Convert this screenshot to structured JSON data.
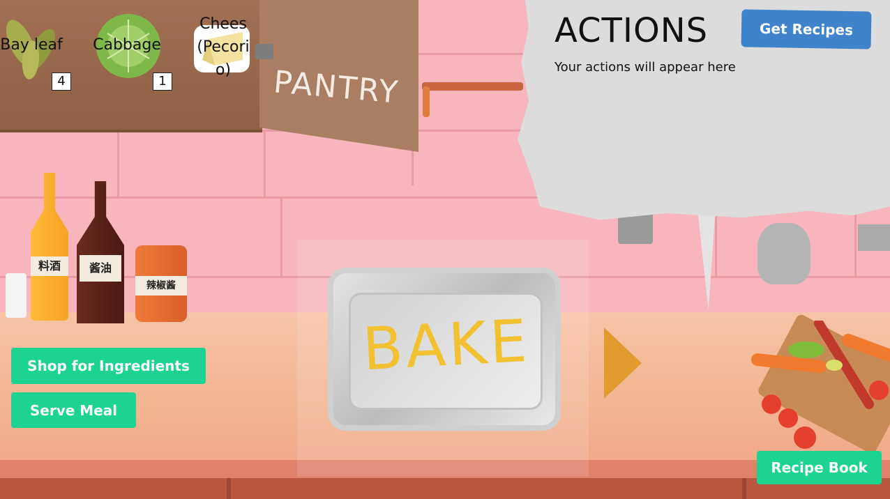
{
  "pantry": {
    "label": "PANTRY",
    "ingredients": [
      {
        "name": "Bay leaf",
        "count": "4"
      },
      {
        "name": "Cabbage",
        "count": "1"
      },
      {
        "name_lines": [
          "Chees",
          "(Pecori",
          "o)"
        ]
      }
    ]
  },
  "actions": {
    "title": "ACTIONS",
    "placeholder": "Your actions will appear here"
  },
  "buttons": {
    "get_recipes": "Get Recipes",
    "shop": "Shop for Ingredients",
    "serve": "Serve Meal",
    "recipe_book": "Recipe Book"
  },
  "bake": {
    "label": "BAKE"
  },
  "bottle_labels": [
    "料酒",
    "酱油",
    "辣椒酱"
  ],
  "colors": {
    "wall": "#f8b5bd",
    "green_button": "#1dd392",
    "blue_button": "#3f83cb",
    "bake_text": "#f2c132",
    "arrow": "#e09a2e"
  },
  "icons": [
    "bay-leaf-icon",
    "cabbage-icon",
    "cheese-icon",
    "next-arrow-icon"
  ]
}
